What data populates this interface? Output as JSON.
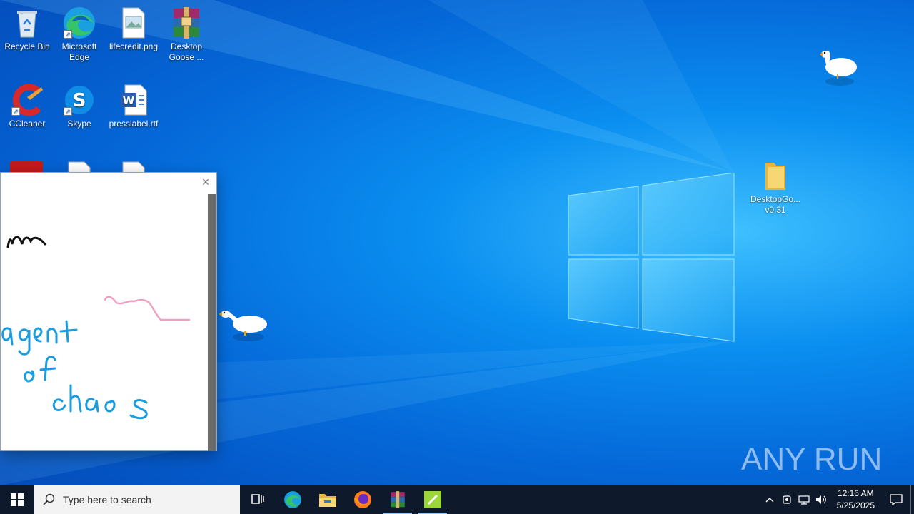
{
  "desktop": {
    "icons": [
      {
        "label": "Recycle Bin",
        "icon": "recycle-bin-icon"
      },
      {
        "label": "Microsoft Edge",
        "icon": "edge-icon"
      },
      {
        "label": "lifecredit.png",
        "icon": "image-file-icon"
      },
      {
        "label": "Desktop Goose ...",
        "icon": "winrar-archive-icon"
      },
      {
        "label": "CCleaner",
        "icon": "ccleaner-icon"
      },
      {
        "label": "Skype",
        "icon": "skype-icon"
      },
      {
        "label": "presslabel.rtf",
        "icon": "word-document-icon"
      },
      {
        "label": "DesktopGo... v0.31",
        "icon": "folder-icon"
      }
    ]
  },
  "note_window": {
    "handwriting": [
      "m",
      "agent",
      "of",
      "chaos"
    ],
    "ink_colors": {
      "black": "#111111",
      "blue": "#1a9de0",
      "pink": "#f0a0c0"
    }
  },
  "taskbar": {
    "search_placeholder": "Type here to search",
    "apps": [
      "task-view-icon",
      "edge-icon",
      "file-explorer-icon",
      "firefox-icon",
      "winrar-icon",
      "desktop-goose-icon"
    ],
    "clock_time": "12:16 AM",
    "clock_date": "5/25/2025"
  },
  "watermark": {
    "text": "ANY RUN"
  },
  "colors": {
    "taskbar": "#0e1a2b",
    "desktop_blue": "#0a8ef0"
  }
}
